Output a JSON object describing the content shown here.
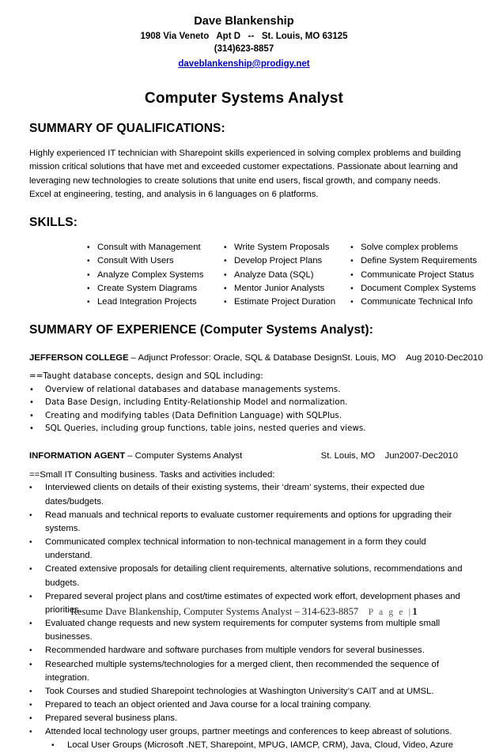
{
  "header": {
    "name": "Dave Blankenship",
    "address": "1908 Via Veneto   Apt D   --   St. Louis, MO 63125",
    "phone": "(314)623-8857",
    "email": "daveblankenship@prodigy.net",
    "link_color": "#0000cc"
  },
  "job_title": "Computer Systems Analyst",
  "summary": {
    "heading": "SUMMARY OF QUALIFICATIONS:",
    "paragraph": "Highly experienced IT technician with Sharepoint skills experienced in solving complex problems and building mission critical solutions that have met and exceeded customer expectations.  Passionate about learning and leveraging new technologies to create solutions that unite end users, fiscal growth, and company needs. Excel at engineering, testing, and analysis in 6 languages on 6 platforms."
  },
  "skills": {
    "heading": "SKILLS:",
    "column1": [
      "Consult with Management",
      "Consult With Users",
      "Analyze Complex Systems",
      "Create System Diagrams",
      "Lead Integration Projects"
    ],
    "column2": [
      "Write System Proposals",
      "Develop Project Plans",
      "Analyze Data (SQL)",
      "Mentor Junior Analysts",
      "Estimate Project Duration"
    ],
    "column3": [
      "Solve complex problems",
      "Define System Requirements",
      "Communicate Project Status",
      "Document Complex Systems",
      "Communicate Technical Info"
    ]
  },
  "experience": {
    "heading": "SUMMARY OF EXPERIENCE (Computer Systems Analyst):",
    "jobs": [
      {
        "org": "JEFFERSON COLLEGE",
        "role": " – Adjunct Professor: Oracle, SQL & Database Design",
        "location": "St. Louis, MO",
        "dates": "Aug 2010-Dec2010",
        "lead": "==Taught database concepts, design and SQL including:",
        "bullets": [
          "Overview of relational databases and database managements systems.",
          "Data Base Design, including Entity-Relationship Model and normalization.",
          "Creating and modifying tables (Data Definition Language) with SQLPlus.",
          "SQL Queries, including group functions, table joins, nested queries and views."
        ],
        "sub_bullets": []
      },
      {
        "org": "INFORMATION AGENT",
        "role": " – Computer Systems Analyst",
        "location": "St. Louis, MO",
        "dates": "Jun2007-Dec2010",
        "lead": "==Small IT Consulting business. Tasks and activities included:",
        "bullets": [
          "Interviewed clients on details of their existing systems, their ‘dream’ systems, their expected due dates/budgets.",
          "Read manuals and technical reports to evaluate customer requirements and options for upgrading their systems.",
          "Communicated complex technical information to non-technical management in a form they could understand.",
          "Created extensive proposals for detailing client requirements, alternative solutions, recommendations and budgets.",
          "Prepared several project plans and cost/time estimates of expected work effort, development phases and priorities.",
          "Evaluated change requests and new system requirements for computer systems from multiple small businesses.",
          "Recommended hardware and software purchases from multiple vendors for several businesses.",
          "Researched multiple systems/technologies for a merged client, then recommended the sequence of integration.",
          "Took Courses and studied Sharepoint technologies at Washington University’s CAIT and at UMSL.",
          "Prepared to teach an object oriented and Java course for a local training company.",
          "Prepared several business plans.",
          "Attended local technology user groups, partner meetings and conferences to keep abreast of solutions."
        ],
        "sub_bullets": [
          "Local User Groups (Microsoft .NET, Sharepoint, MPUG, IAMCP, CRM), Java, Cloud, Video, Azure"
        ]
      }
    ]
  },
  "footer": {
    "text": "Resume Dave Blankenship, Computer Systems Analyst – 314-623-8857",
    "page_label": "P a g e  |",
    "page_number": "1"
  }
}
